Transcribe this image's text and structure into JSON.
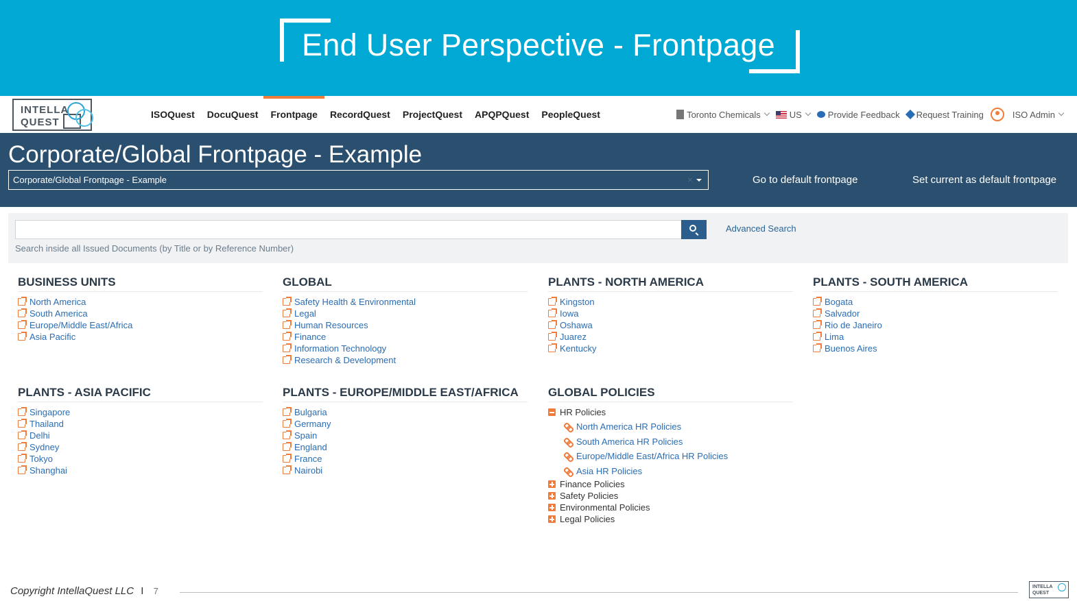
{
  "slide": {
    "title": "End User Perspective - Frontpage"
  },
  "logo": {
    "line1": "INTELLA",
    "line2": "QUEST"
  },
  "nav": {
    "items": [
      {
        "label": "ISOQuest",
        "active": false
      },
      {
        "label": "DocuQuest",
        "active": false
      },
      {
        "label": "Frontpage",
        "active": true
      },
      {
        "label": "RecordQuest",
        "active": false
      },
      {
        "label": "ProjectQuest",
        "active": false
      },
      {
        "label": "APQPQuest",
        "active": false
      },
      {
        "label": "PeopleQuest",
        "active": false
      }
    ],
    "right": {
      "company": "Toronto Chemicals",
      "locale": "US",
      "feedback": "Provide Feedback",
      "training": "Request Training",
      "user": "ISO Admin"
    }
  },
  "header": {
    "title": "Corporate/Global Frontpage - Example",
    "selected_frontpage": "Corporate/Global Frontpage - Example",
    "clear_symbol": "×",
    "default_button": "Go to default frontpage",
    "set_default_button": "Set current as default frontpage"
  },
  "search": {
    "value": "",
    "advanced": "Advanced Search",
    "hint": "Search inside all Issued Documents (by Title or by Reference Number)"
  },
  "sections": [
    {
      "title": "BUSINESS UNITS",
      "links": [
        "North America",
        "South America",
        "Europe/Middle East/Africa",
        "Asia Pacific"
      ]
    },
    {
      "title": "GLOBAL",
      "links": [
        "Safety Health & Environmental",
        "Legal",
        "Human Resources",
        "Finance",
        "Information Technology",
        "Research & Development"
      ]
    },
    {
      "title": "PLANTS - NORTH AMERICA",
      "links": [
        "Kingston",
        "Iowa",
        "Oshawa",
        "Juarez",
        "Kentucky"
      ]
    },
    {
      "title": "PLANTS - SOUTH AMERICA",
      "links": [
        "Bogata",
        "Salvador",
        "Rio de Janeiro",
        "Lima",
        "Buenos Aires"
      ]
    },
    {
      "title": "PLANTS - ASIA PACIFIC",
      "links": [
        "Singapore",
        "Thailand",
        "Delhi",
        "Sydney",
        "Tokyo",
        "Shanghai"
      ]
    },
    {
      "title": "PLANTS - EUROPE/MIDDLE EAST/AFRICA",
      "links": [
        "Bulgaria",
        "Germany",
        "Spain",
        "England",
        "France",
        "Nairobi"
      ]
    }
  ],
  "policies": {
    "title": "GLOBAL POLICIES",
    "expanded": {
      "label": "HR Policies",
      "children": [
        "North America HR Policies",
        "South America HR Policies",
        "Europe/Middle East/Africa HR Policies",
        "Asia HR Policies"
      ]
    },
    "collapsed": [
      "Finance Policies",
      "Safety Policies",
      "Environmental Policies",
      "Legal Policies"
    ]
  },
  "footer": {
    "copyright": "Copyright IntellaQuest LLC",
    "separator": "I",
    "page": "7"
  },
  "colors": {
    "banner": "#00a8d4",
    "header": "#2b4f6e",
    "accent": "#f07c3c",
    "link": "#2a6db5"
  }
}
